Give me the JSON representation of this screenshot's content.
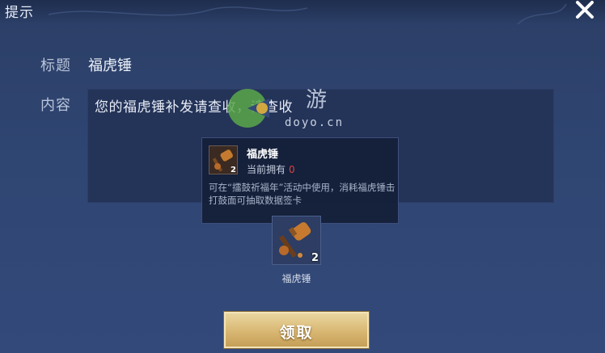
{
  "dialog": {
    "title": "提示",
    "close_icon": "close-icon"
  },
  "form": {
    "title_label": "标题",
    "title_value": "福虎锤",
    "content_label": "内容",
    "content_value": "您的福虎锤补发请查收，请查收"
  },
  "watermark": {
    "text": "doyo.cn",
    "logo_text": "游"
  },
  "tooltip": {
    "item_name": "福虎锤",
    "item_qty": "2",
    "own_label": "当前拥有",
    "own_count": "0",
    "description": "可在“擂鼓祈福年”活动中使用，消耗福虎锤击打鼓面可抽取数据签卡"
  },
  "reward": {
    "item_name": "福虎锤",
    "qty": "2",
    "icon": "hammer-icon"
  },
  "buttons": {
    "claim_label": "领取"
  },
  "colors": {
    "background": "#2f4571",
    "button_gold": "#d8b772",
    "own_count_red": "#d64444"
  }
}
